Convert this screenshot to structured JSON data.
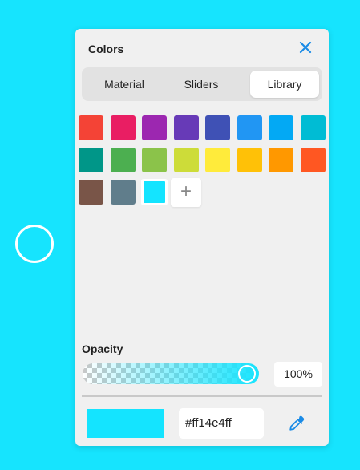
{
  "panel": {
    "title": "Colors"
  },
  "tabs": [
    {
      "label": "Material"
    },
    {
      "label": "Sliders"
    },
    {
      "label": "Library"
    }
  ],
  "active_tab": "Library",
  "swatches": [
    {
      "color": "#f44336"
    },
    {
      "color": "#e91e63"
    },
    {
      "color": "#9c27b0"
    },
    {
      "color": "#673ab7"
    },
    {
      "color": "#3f51b5"
    },
    {
      "color": "#2196f3"
    },
    {
      "color": "#03a9f4"
    },
    {
      "color": "#00bcd4"
    },
    {
      "color": "#009688"
    },
    {
      "color": "#4caf50"
    },
    {
      "color": "#8bc34a"
    },
    {
      "color": "#cddc39"
    },
    {
      "color": "#ffeb3b"
    },
    {
      "color": "#ffc107"
    },
    {
      "color": "#ff9800"
    },
    {
      "color": "#ff5722"
    },
    {
      "color": "#795548"
    },
    {
      "color": "#607d8b"
    },
    {
      "color": "#14e4ff"
    }
  ],
  "add_button": {
    "label": "+"
  },
  "opacity": {
    "label": "Opacity",
    "value_text": "100%",
    "value": 1.0
  },
  "current": {
    "color": "#14e4ff",
    "hex": "#ff14e4ff"
  },
  "colors": {
    "background": "#16e4fe",
    "accent": "#1a8be6"
  },
  "icons": {
    "close": "close-icon",
    "eyedropper": "eyedropper-icon"
  }
}
